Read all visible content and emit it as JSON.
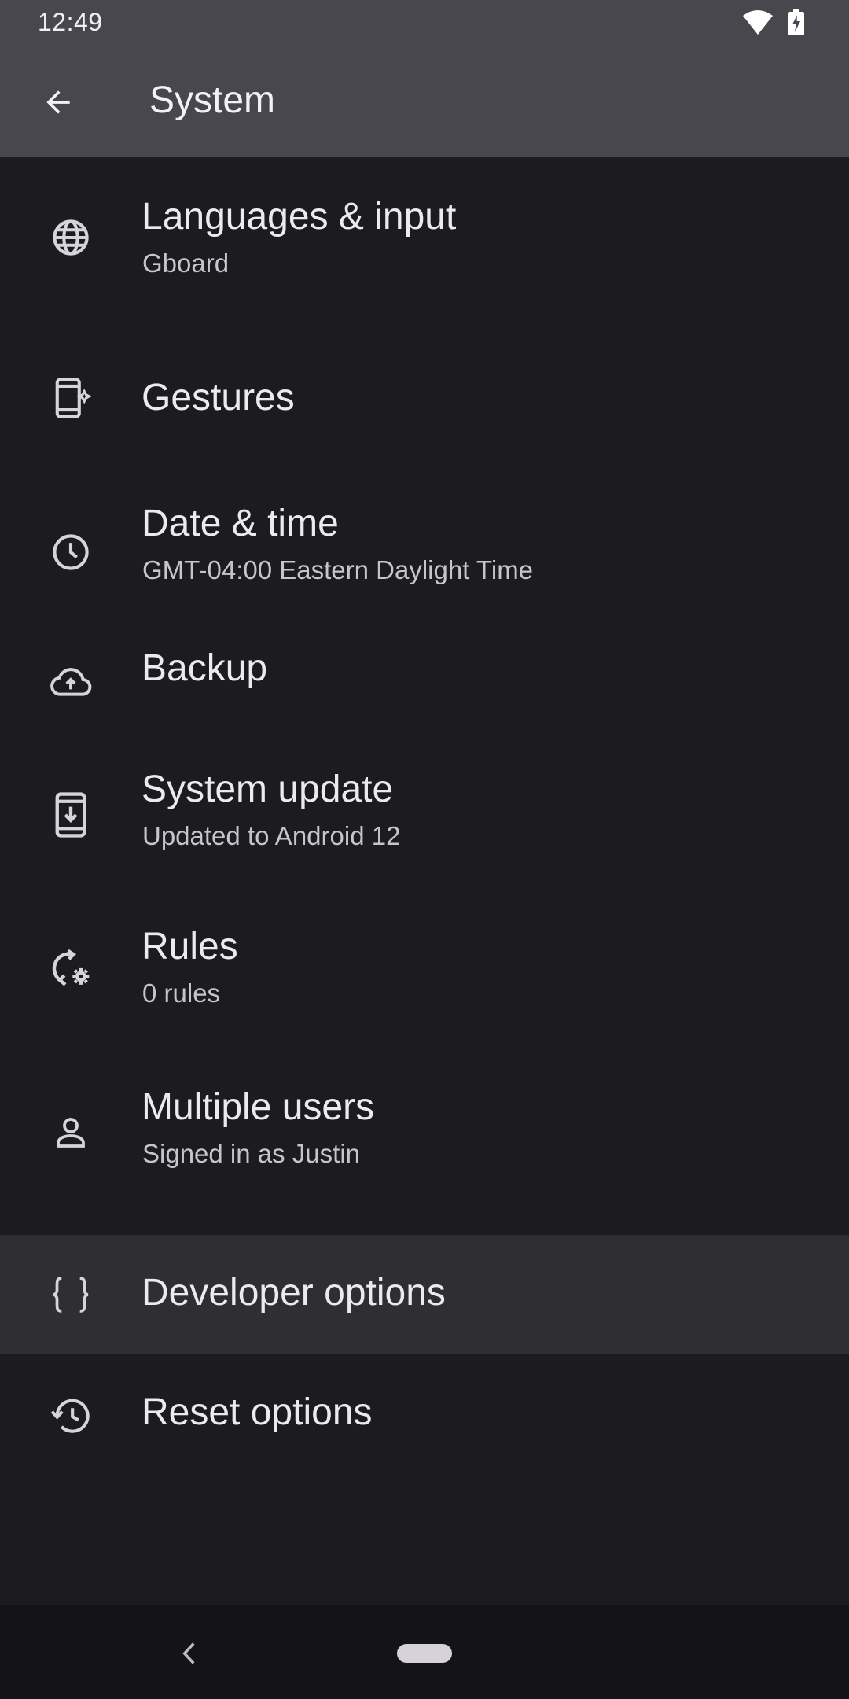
{
  "status_bar": {
    "time": "12:49",
    "icons": [
      "wifi-icon",
      "battery-charging-icon"
    ]
  },
  "app_bar": {
    "title": "System",
    "back_icon": "arrow-back-icon"
  },
  "items": [
    {
      "id": "languages",
      "icon": "globe-icon",
      "title": "Languages & input",
      "subtitle": "Gboard"
    },
    {
      "id": "gestures",
      "icon": "phone-sparkle-icon",
      "title": "Gestures",
      "subtitle": ""
    },
    {
      "id": "date-time",
      "icon": "clock-icon",
      "title": "Date & time",
      "subtitle": "GMT-04:00 Eastern Daylight Time"
    },
    {
      "id": "backup",
      "icon": "cloud-upload-icon",
      "title": "Backup",
      "subtitle": ""
    },
    {
      "id": "system-update",
      "icon": "system-update-icon",
      "title": "System update",
      "subtitle": "Updated to Android 12"
    },
    {
      "id": "rules",
      "icon": "rules-sync-gear-icon",
      "title": "Rules",
      "subtitle": "0 rules"
    },
    {
      "id": "multiple-users",
      "icon": "person-icon",
      "title": "Multiple users",
      "subtitle": "Signed in as Justin"
    },
    {
      "id": "developer-options",
      "icon": "braces-icon",
      "title": "Developer options",
      "subtitle": ""
    },
    {
      "id": "reset-options",
      "icon": "history-icon",
      "title": "Reset options",
      "subtitle": ""
    }
  ],
  "nav_bar": {
    "back_icon": "chevron-left-icon",
    "home_icon": "home-pill-icon"
  },
  "colors": {
    "app_bar": "#48474d",
    "background": "#1c1b20",
    "highlight": "#2f2e33",
    "nav_bar": "#141318"
  }
}
